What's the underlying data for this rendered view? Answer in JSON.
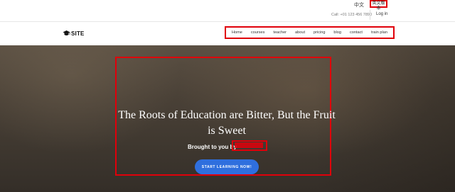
{
  "topbar": {
    "lang_zh": "中文",
    "lang_en": "英文版本",
    "call": "Call: +01 123 456 7890",
    "login": "Log in"
  },
  "navbar": {
    "logo_text": "SITE",
    "logo_icon": "graduation-cap-icon",
    "items": [
      "Home",
      "courses",
      "teacher",
      "about",
      "pricing",
      "blog",
      "contact",
      "train plan"
    ]
  },
  "hero": {
    "title": "The Roots of Education are Bitter, But the Fruit is Sweet",
    "subtitle": "Brought to you by",
    "button": "START LEARNING NOW!"
  },
  "colors": {
    "annotation_red": "#e0000a",
    "button_blue": "#2f6fde"
  }
}
